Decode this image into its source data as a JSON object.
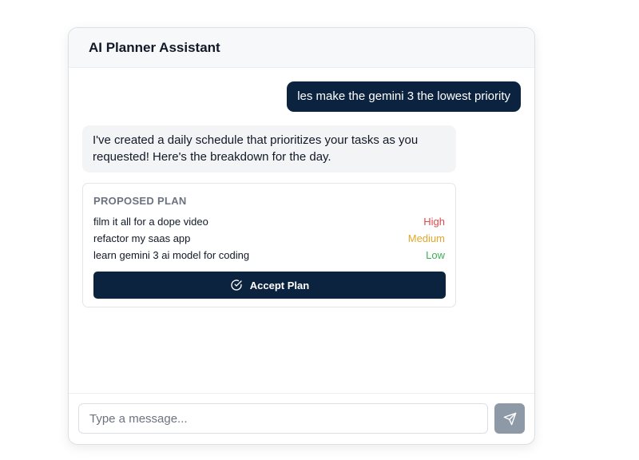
{
  "header": {
    "title": "AI Planner Assistant"
  },
  "messages": {
    "user": "les make the gemini 3 the lowest priority",
    "assistant": "I've created a daily schedule that prioritizes your tasks as you requested! Here's the breakdown for the day."
  },
  "plan": {
    "title": "PROPOSED PLAN",
    "items": [
      {
        "task": "film it all for a dope video",
        "priority": "High"
      },
      {
        "task": "refactor my saas app",
        "priority": "Medium"
      },
      {
        "task": "learn gemini 3 ai model for coding",
        "priority": "Low"
      }
    ],
    "accept_label": "Accept Plan",
    "accept_icon": "check-circle-icon"
  },
  "composer": {
    "placeholder": "Type a message...",
    "value": "",
    "send_icon": "send-icon"
  },
  "colors": {
    "accent": "#0c2340",
    "high": "#e04a4a",
    "medium": "#e0a82a",
    "low": "#3fae5a",
    "send_button": "#8d99a6"
  }
}
